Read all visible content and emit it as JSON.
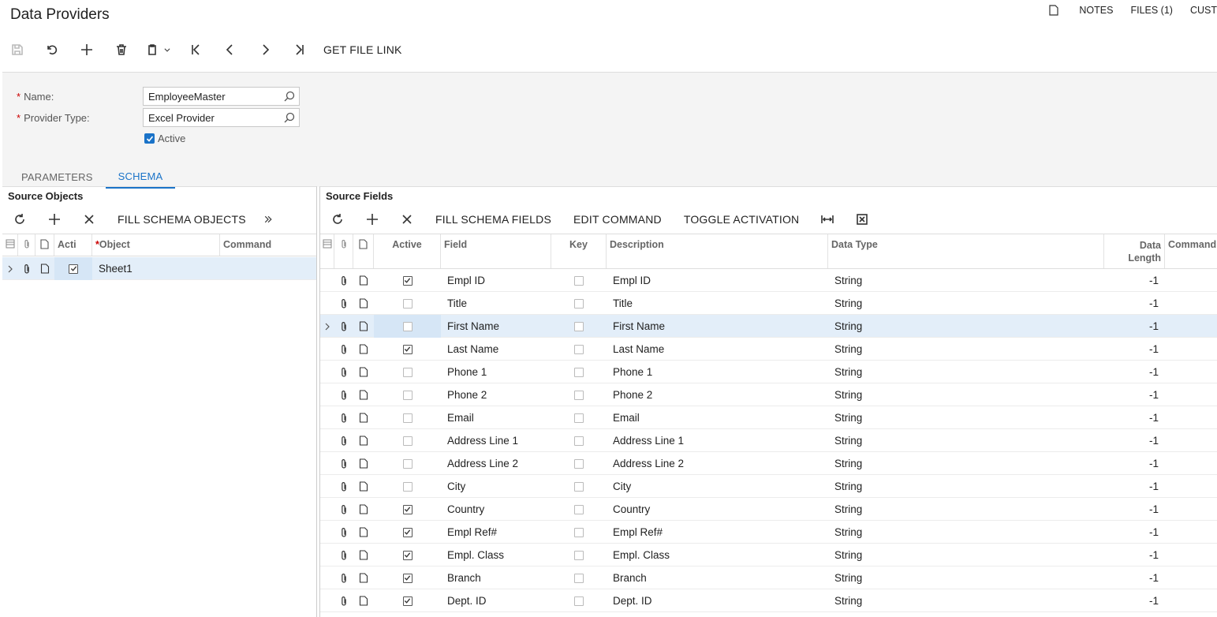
{
  "page": {
    "title": "Data Providers"
  },
  "top_links": {
    "notes": "NOTES",
    "files": "FILES (1)",
    "customization": "CUST"
  },
  "toolbar": {
    "get_file_link": "GET FILE LINK"
  },
  "form": {
    "name_label": "Name:",
    "name_value": "EmployeeMaster",
    "provider_type_label": "Provider Type:",
    "provider_type_value": "Excel Provider",
    "active_label": "Active",
    "required_mark": "*"
  },
  "tabs": [
    {
      "label": "PARAMETERS",
      "active": false
    },
    {
      "label": "SCHEMA",
      "active": true
    }
  ],
  "source_objects": {
    "title": "Source Objects",
    "fill_label": "FILL SCHEMA OBJECTS",
    "columns": {
      "active": "Acti",
      "object": "Object",
      "command": "Command",
      "required_mark": "*"
    },
    "rows": [
      {
        "object": "Sheet1",
        "active": true
      }
    ]
  },
  "source_fields": {
    "title": "Source Fields",
    "actions": {
      "fill": "FILL SCHEMA FIELDS",
      "edit": "EDIT COMMAND",
      "toggle": "TOGGLE ACTIVATION"
    },
    "columns": {
      "active": "Active",
      "field": "Field",
      "key": "Key",
      "description": "Description",
      "data_type": "Data Type",
      "data_length_1": "Data",
      "data_length_2": "Length",
      "command": "Command"
    },
    "rows": [
      {
        "active": true,
        "field": "Empl ID",
        "description": "Empl ID",
        "type": "String",
        "length": "-1"
      },
      {
        "active": false,
        "field": "Title",
        "description": "Title",
        "type": "String",
        "length": "-1"
      },
      {
        "active": false,
        "field": "First Name",
        "description": "First Name",
        "type": "String",
        "length": "-1"
      },
      {
        "active": true,
        "field": "Last Name",
        "description": "Last Name",
        "type": "String",
        "length": "-1"
      },
      {
        "active": false,
        "field": "Phone 1",
        "description": "Phone 1",
        "type": "String",
        "length": "-1"
      },
      {
        "active": false,
        "field": "Phone 2",
        "description": "Phone 2",
        "type": "String",
        "length": "-1"
      },
      {
        "active": false,
        "field": "Email",
        "description": "Email",
        "type": "String",
        "length": "-1"
      },
      {
        "active": false,
        "field": "Address Line 1",
        "description": "Address Line 1",
        "type": "String",
        "length": "-1"
      },
      {
        "active": false,
        "field": "Address Line 2",
        "description": "Address Line 2",
        "type": "String",
        "length": "-1"
      },
      {
        "active": false,
        "field": "City",
        "description": "City",
        "type": "String",
        "length": "-1"
      },
      {
        "active": true,
        "field": "Country",
        "description": "Country",
        "type": "String",
        "length": "-1"
      },
      {
        "active": true,
        "field": "Empl Ref#",
        "description": "Empl Ref#",
        "type": "String",
        "length": "-1"
      },
      {
        "active": true,
        "field": "Empl. Class",
        "description": "Empl. Class",
        "type": "String",
        "length": "-1"
      },
      {
        "active": true,
        "field": "Branch",
        "description": "Branch",
        "type": "String",
        "length": "-1"
      },
      {
        "active": true,
        "field": "Dept. ID",
        "description": "Dept. ID",
        "type": "String",
        "length": "-1"
      }
    ]
  },
  "colors": {
    "accent": "#1a73c8",
    "selected_row": "#e3eef9"
  }
}
